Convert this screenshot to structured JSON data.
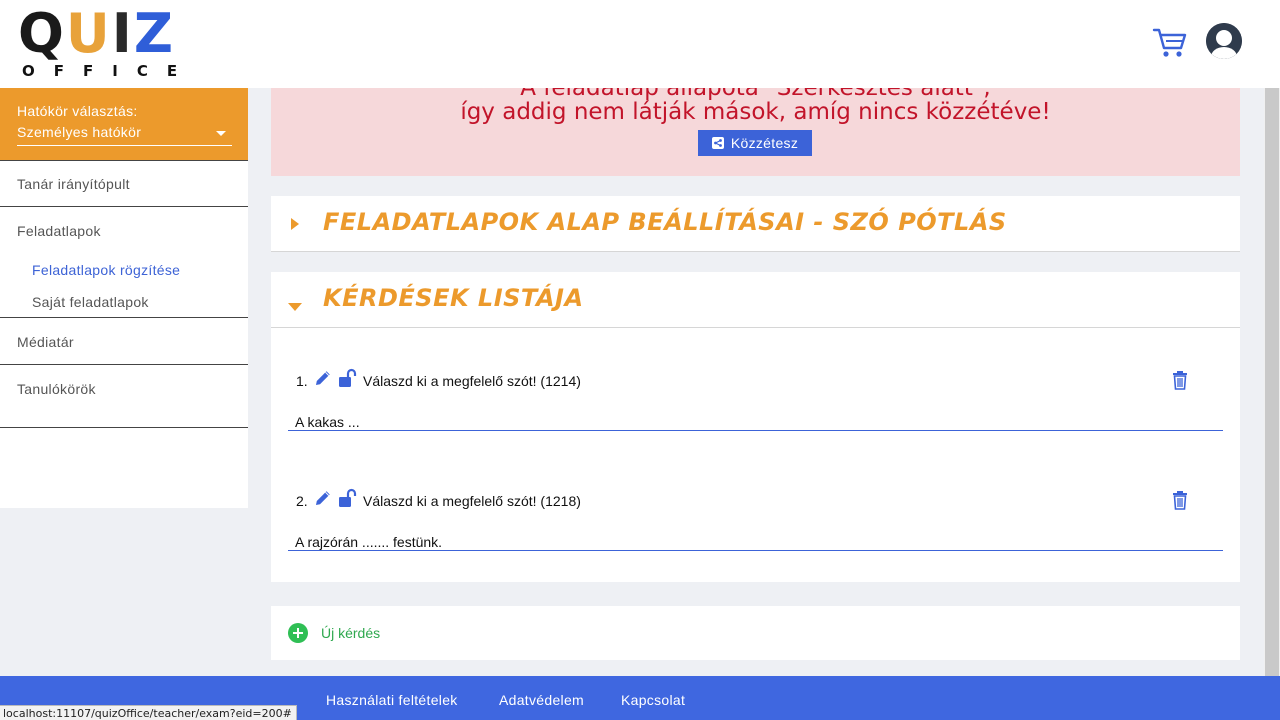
{
  "header": {
    "logo_word": "QUIZ",
    "logo_sub": "OFFICE",
    "cart_icon": "cart-icon",
    "avatar_icon": "user-avatar-icon"
  },
  "sidebar": {
    "scope_label": "Hatókör választás:",
    "scope_value": "Személyes hatókör",
    "items": [
      {
        "label": "Tanár irányítópult",
        "level": "main"
      },
      {
        "label": "Feladatlapok",
        "level": "main"
      },
      {
        "label": "Feladatlapok rögzítése",
        "level": "sub",
        "active": true
      },
      {
        "label": "Saját feladatlapok",
        "level": "sub"
      },
      {
        "label": "Médiatár",
        "level": "main"
      },
      {
        "label": "Tanulókörök",
        "level": "main"
      }
    ]
  },
  "alert": {
    "line1": "A feladatlap állapota \"Szerkesztés alatt\",",
    "line2": "így addig nem látják mások, amíg nincs közzétéve!",
    "button": "Közzétesz"
  },
  "panels": {
    "settings_title": "FELADATLAPOK ALAP BEÁLLÍTÁSAI - SZÓ PÓTLÁS",
    "questions_title": "KÉRDÉSEK LISTÁJA"
  },
  "questions": [
    {
      "num": "1.",
      "title": "Válaszd ki a megfelelő szót! (1214)",
      "text": "A kakas ..."
    },
    {
      "num": "2.",
      "title": "Válaszd ki a megfelelő szót! (1218)",
      "text": "A rajzórán ....... festünk."
    }
  ],
  "new_question": "Új kérdés",
  "footer": {
    "links": [
      "Használati feltételek",
      "Adatvédelem",
      "Kapcsolat"
    ]
  },
  "status_url": "localhost:11107/quizOffice/teacher/exam?eid=200#",
  "colors": {
    "accent_orange": "#ec9a2c",
    "primary_blue": "#3f67e0",
    "alert_red": "#c2142a",
    "alert_bg": "#f6d8da",
    "success_green": "#2fbf55"
  }
}
